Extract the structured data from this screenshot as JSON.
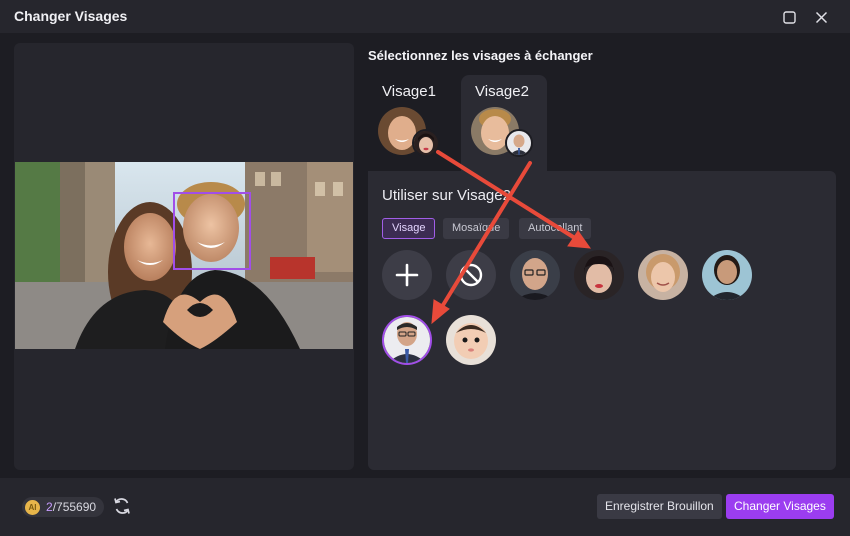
{
  "window": {
    "title": "Changer Visages",
    "maximize_icon": "maximize-icon",
    "close_icon": "close-icon"
  },
  "right": {
    "title": "Sélectionnez les visages à échanger",
    "tabs": [
      {
        "label": "Visage1",
        "selected": false
      },
      {
        "label": "Visage2",
        "selected": true
      }
    ],
    "library_title": "Utiliser sur Visage2",
    "chips": [
      {
        "label": "Visage",
        "active": true
      },
      {
        "label": "Mosaïque",
        "active": false
      },
      {
        "label": "Autocollant",
        "active": false
      }
    ],
    "tools": [
      {
        "name": "add-face-button",
        "icon": "plus-icon"
      },
      {
        "name": "no-swap-button",
        "icon": "prohibited-icon"
      }
    ],
    "faces": [
      {
        "name": "face-older-man-glasses",
        "selected": false
      },
      {
        "name": "face-woman-bangs",
        "selected": false
      },
      {
        "name": "face-blonde-woman",
        "selected": false
      },
      {
        "name": "face-business-woman",
        "selected": false
      },
      {
        "name": "face-man-suit-glasses",
        "selected": true
      },
      {
        "name": "face-baby",
        "selected": false
      }
    ]
  },
  "bottom": {
    "credits_used": "2",
    "credits_total": "/755690",
    "refresh_icon": "refresh-icon",
    "draft_label": "Enregistrer Brouillon",
    "swap_label": "Changer Visages"
  },
  "colors": {
    "accent": "#9b3df0",
    "arrow": "#e84a3a"
  }
}
